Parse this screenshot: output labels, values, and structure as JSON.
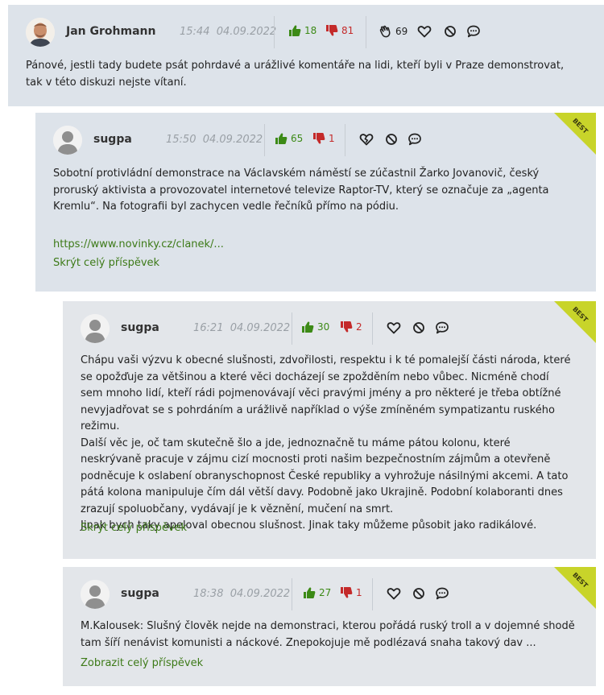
{
  "comments": [
    {
      "author": "Jan Grohmann",
      "time": "15:44",
      "date": "04.09.2022",
      "likes": "18",
      "dislikes": "81",
      "applause": "69",
      "text": "Pánové, jestli tady budete psát pohrdavé a urážlivé komentáře na lidi, kteří byli v Praze demonstrovat, tak v této diskuzi nejste vítaní."
    },
    {
      "author": "sugpa",
      "time": "15:50",
      "date": "04.09.2022",
      "likes": "65",
      "dislikes": "1",
      "badge": "BEST",
      "text": "Sobotní protivládní demonstrace na Václavském náměstí se zúčastnil Žarko Jovanovič, český proruský aktivista a provozovatel internetové televize Raptor-TV, který se označuje za „agenta Kremlu“. Na fotografii byl zachycen vedle řečníků přímo na pódiu.",
      "link": "https://www.novinky.cz/clanek/...",
      "toggle": "Skrýt celý příspěvek"
    },
    {
      "author": "sugpa",
      "time": "16:21",
      "date": "04.09.2022",
      "likes": "30",
      "dislikes": "2",
      "badge": "BEST",
      "lines": [
        "Chápu vaši výzvu k obecné slušnosti, zdvořilosti, respektu i k té pomalejší části národa, které se opožďuje za většinou a které věci docházejí se zpožděním nebo vůbec. Nicméně chodí sem mnoho lidí, kteří rádi pojmenovávají věci pravými jmény a pro některé je třeba obtížné nevyjadřovat se s pohrdáním a urážlivě například o výše zmíněném sympatizantu ruského režimu.",
        "Další věc je, oč tam skutečně šlo a jde, jednoznačně tu máme pátou kolonu, které neskrývaně pracuje v zájmu cizí mocnosti proti našim bezpečnostním zájmům a otevřeně podněcuje k oslabení obranyschopnost České republiky a vyhrožuje násilnými akcemi. A tato pátá kolona manipuluje čím dál větší davy. Podobně jako Ukrajině. Podobní kolaboranti dnes zrazují spoluobčany, vydávají je k věznění, mučení na smrt.",
        "Jinak bych taky apeloval obecnou slušnost. Jinak taky můžeme působit jako radikálové."
      ],
      "toggle": "Skrýt celý příspěvek"
    },
    {
      "author": "sugpa",
      "time": "18:38",
      "date": "04.09.2022",
      "likes": "27",
      "dislikes": "1",
      "badge": "BEST",
      "text": "M.Kalousek: Slušný člověk nejde na demonstraci, kterou pořádá ruský troll a v dojemné shodě tam šíří nenávist komunisti a náckové. Znepokojuje mě podlézavá snaha takový dav ...",
      "toggle": "Zobrazit celý příspěvek"
    }
  ],
  "colors": {
    "up": "#3c8a16",
    "down": "#c42a2a",
    "link": "#3d7a18",
    "badge": "#c8d42a"
  },
  "icons": [
    "thumbs-up-icon",
    "thumbs-down-icon",
    "applause-icon",
    "heart-icon",
    "broken-heart-icon",
    "block-icon",
    "reply-bubble-icon"
  ]
}
